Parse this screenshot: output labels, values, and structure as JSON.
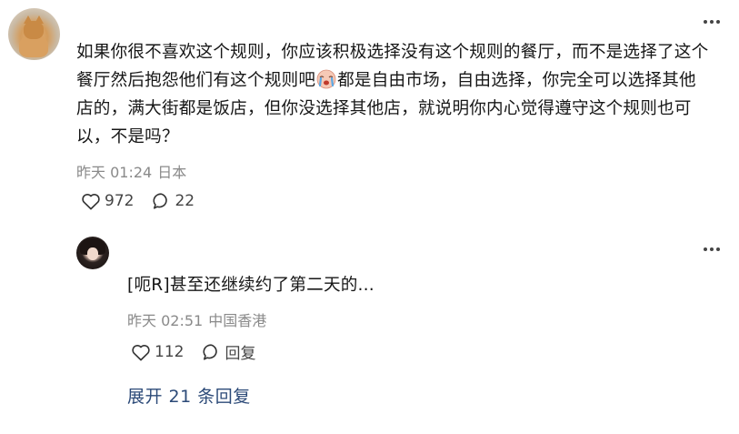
{
  "comment": {
    "text_part1": "如果你很不喜欢这个规则，你应该积极选择没有这个规则的餐厅，而不是选择了这个餐厅然后抱怨他们有这个规则吧",
    "text_part2": "都是自由市场，自由选择，你完全可以选择其他店的，满大街都是饭店，但你没选择其他店，就说明你内心觉得遵守这个规则也可以，不是吗？",
    "time": "昨天 01:24",
    "location": "日本",
    "likes": "972",
    "replies": "22"
  },
  "reply": {
    "text": "[呃R]甚至还继续约了第二天的...",
    "time": "昨天 02:51",
    "location": "中国香港",
    "likes": "112",
    "reply_label": "回复"
  },
  "expand_label": "展开 21 条回复",
  "icons": {
    "like": "heart-outline-icon",
    "comment": "speech-bubble-icon",
    "more": "more-dots-icon",
    "emoji": "crying-face-emoji"
  },
  "colors": {
    "link": "#2c4a78",
    "meta": "#8a8a8a",
    "text": "#171717"
  }
}
